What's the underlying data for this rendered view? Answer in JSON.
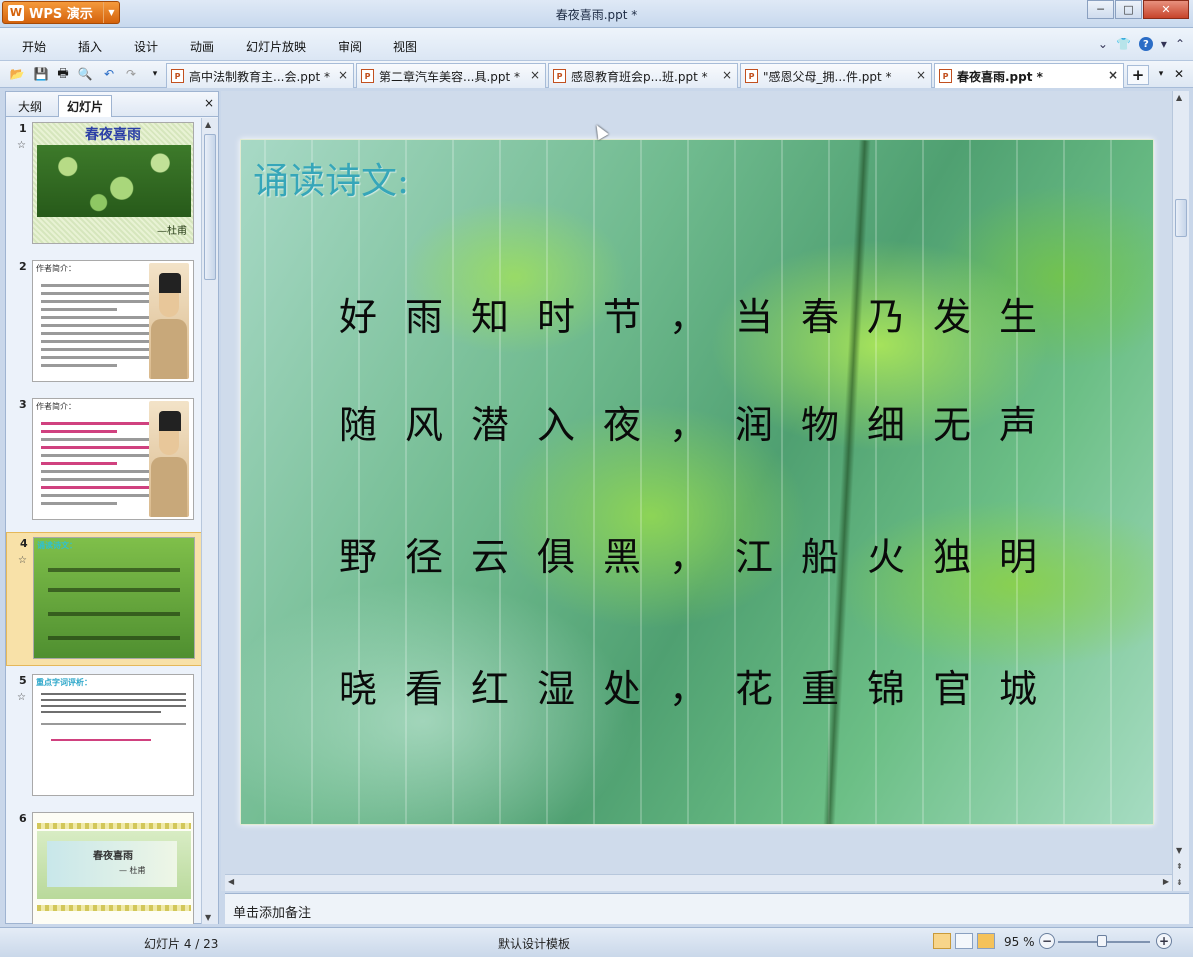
{
  "app": {
    "button_label": "WPS 演示",
    "logo_glyph": "W"
  },
  "window": {
    "title": "春夜喜雨.ppt *",
    "min": "─",
    "max": "□",
    "close": "✕"
  },
  "menu": {
    "items": [
      "开始",
      "插入",
      "设计",
      "动画",
      "幻灯片放映",
      "审阅",
      "视图"
    ]
  },
  "tabs": [
    {
      "label": "高中法制教育主...会.ppt *"
    },
    {
      "label": "第二章汽车美容...具.ppt *"
    },
    {
      "label": "感恩教育班会p...班.ppt *"
    },
    {
      "label": "\"感恩父母_拥...件.ppt *"
    },
    {
      "label": "春夜喜雨.ppt *"
    }
  ],
  "tab_close_glyph": "×",
  "tab_plus_glyph": "+",
  "panel": {
    "tab_outline": "大纲",
    "tab_slides": "幻灯片",
    "close_glyph": "×"
  },
  "thumbnails": {
    "numbers": [
      "1",
      "2",
      "3",
      "4",
      "5",
      "6"
    ],
    "star": "☆",
    "slide1_title": "春夜喜雨",
    "slide1_author": "—杜甫",
    "slide2_head": "作者简介：",
    "slide3_head": "作者简介：",
    "slide4_head": "诵读诗文：",
    "slide5_head": "重点字词评析：",
    "slide6_title": "春夜喜雨",
    "slide6_author": "— 杜甫"
  },
  "slide": {
    "heading": "诵读诗文:",
    "lines": [
      [
        "好",
        "雨",
        "知",
        "时",
        "节",
        "，",
        "当",
        "春",
        "乃",
        "发",
        "生"
      ],
      [
        "随",
        "风",
        "潜",
        "入",
        "夜",
        "，",
        "润",
        "物",
        "细",
        "无",
        "声"
      ],
      [
        "野",
        "径",
        "云",
        "俱",
        "黑",
        "，",
        "江",
        "船",
        "火",
        "独",
        "明"
      ],
      [
        "晓",
        "看",
        "红",
        "湿",
        "处",
        "，",
        "花",
        "重",
        "锦",
        "官",
        "城"
      ]
    ]
  },
  "notes": {
    "placeholder": "单击添加备注"
  },
  "status": {
    "slide_counter": "幻灯片 4 / 23",
    "template": "默认设计模板",
    "zoom": "95 %",
    "zoom_minus": "−",
    "zoom_plus": "+"
  },
  "colors": {
    "accent_orange": "#d4620c",
    "heading_teal": "#36a6b9",
    "selection": "#f8e1a8"
  }
}
